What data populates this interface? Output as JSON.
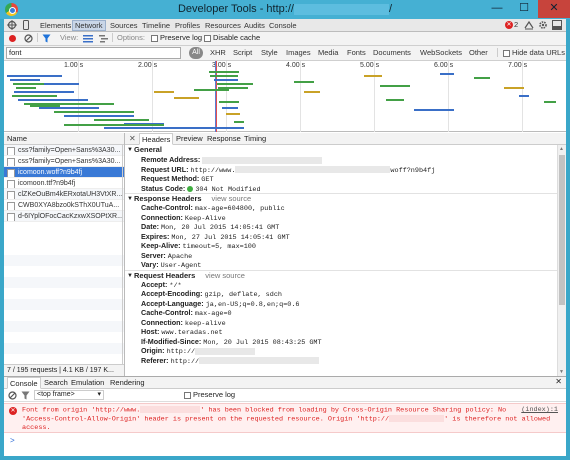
{
  "window": {
    "title_prefix": "Developer Tools - http://",
    "title_suffix": "/",
    "min_glyph": "—",
    "max_glyph": "☐",
    "close_glyph": "✕"
  },
  "main_tabs": [
    "Elements",
    "Network",
    "Sources",
    "Timeline",
    "Profiles",
    "Resources",
    "Audits",
    "Console"
  ],
  "active_main_tab": "Network",
  "error_count": "2",
  "net_toolbar": {
    "view_label": "View:",
    "options_label": "Options:",
    "preserve_log": "Preserve log",
    "disable_cache": "Disable cache"
  },
  "filter": {
    "value": "font",
    "types": [
      "All",
      "XHR",
      "Script",
      "Style",
      "Images",
      "Media",
      "Fonts",
      "Documents",
      "WebSockets",
      "Other"
    ],
    "hide_data_urls": "Hide data URLs"
  },
  "timeline_ticks": [
    "1.00 s",
    "2.00 s",
    "3.00 s",
    "4.00 s",
    "5.00 s",
    "6.00 s",
    "7.00 s"
  ],
  "request_list": {
    "header": "Name",
    "rows": [
      "css?family=Open+Sans%3A30...",
      "css?family=Open+Sans%3A30...",
      "icomoon.woff?n9b4fj",
      "icomoon.ttf?n9b4fj",
      "clZKeOuBm4kERxotaUH3VtXR...",
      "CWB0XYA8bzo0kSThX0UTuA...",
      "d-6IYplOFocCacKzxwXSOPtXR..."
    ],
    "selected_index": 2,
    "summary": "7 / 195 requests  |  4.1 KB / 197 K..."
  },
  "detail_tabs": [
    "Headers",
    "Preview",
    "Response",
    "Timing"
  ],
  "active_detail_tab": "Headers",
  "general": {
    "title": "General",
    "remote_address_k": "Remote Address:",
    "request_url_k": "Request URL:",
    "request_url_prefix": "http://www.",
    "request_url_suffix": "woff?n9b4fj",
    "request_method_k": "Request Method:",
    "request_method_v": "GET",
    "status_code_k": "Status Code:",
    "status_code_v": "304 Not Modified"
  },
  "response_headers": {
    "title": "Response Headers",
    "view_source": "view source",
    "items": [
      {
        "k": "Cache-Control:",
        "v": "max-age=604800, public"
      },
      {
        "k": "Connection:",
        "v": "Keep-Alive"
      },
      {
        "k": "Date:",
        "v": "Mon, 20 Jul 2015 14:05:41 GMT"
      },
      {
        "k": "Expires:",
        "v": "Mon, 27 Jul 2015 14:05:41 GMT"
      },
      {
        "k": "Keep-Alive:",
        "v": "timeout=5, max=100"
      },
      {
        "k": "Server:",
        "v": "Apache"
      },
      {
        "k": "Vary:",
        "v": "User-Agent"
      }
    ]
  },
  "request_headers": {
    "title": "Request Headers",
    "view_source": "view source",
    "items": [
      {
        "k": "Accept:",
        "v": "*/*"
      },
      {
        "k": "Accept-Encoding:",
        "v": "gzip, deflate, sdch"
      },
      {
        "k": "Accept-Language:",
        "v": "ja,en-US;q=0.8,en;q=0.6"
      },
      {
        "k": "Cache-Control:",
        "v": "max-age=0"
      },
      {
        "k": "Connection:",
        "v": "keep-alive"
      },
      {
        "k": "Host:",
        "v": "www.teradas.net"
      },
      {
        "k": "If-Modified-Since:",
        "v": "Mon, 20 Jul 2015 08:43:25 GMT"
      },
      {
        "k": "Origin:",
        "v": "http://"
      },
      {
        "k": "Referer:",
        "v": "http://"
      }
    ]
  },
  "drawer": {
    "tabs": [
      "Console",
      "Search",
      "Emulation",
      "Rendering"
    ],
    "active_tab": "Console",
    "frame": "<top frame>",
    "preserve_log": "Preserve log",
    "error": {
      "line1_a": "Font from origin 'http://www.",
      "line1_b": "' has been blocked from loading by Cross-Origin Resource Sharing policy: No",
      "line2_a": "'Access-Control-Allow-Origin' header is present on the requested resource. Origin 'http://",
      "line2_b": "' is therefore not allowed",
      "line3": "access.",
      "source": "(index):1"
    },
    "prompt": ">"
  }
}
